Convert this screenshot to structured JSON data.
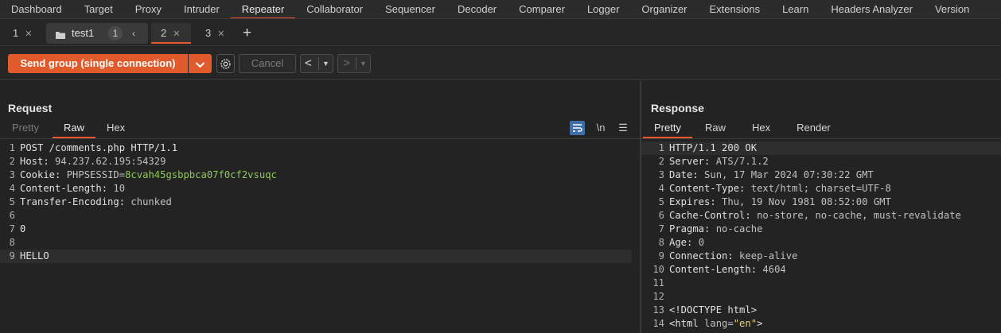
{
  "nav": {
    "items": [
      "Dashboard",
      "Target",
      "Proxy",
      "Intruder",
      "Repeater",
      "Collaborator",
      "Sequencer",
      "Decoder",
      "Comparer",
      "Logger",
      "Organizer",
      "Extensions",
      "Learn",
      "Headers Analyzer",
      "Version"
    ],
    "active": "Repeater"
  },
  "tabs": {
    "tab1": {
      "label": "1"
    },
    "group": {
      "label": "test1",
      "count": "1"
    },
    "tab2": {
      "label": "2"
    },
    "tab3": {
      "label": "3"
    },
    "add": "+"
  },
  "toolbar": {
    "send_label": "Send group (single connection)",
    "cancel_label": "Cancel"
  },
  "request": {
    "title": "Request",
    "tabs": [
      "Pretty",
      "Raw",
      "Hex"
    ],
    "active_tab": "Raw",
    "newline_icon_label": "\\n",
    "lines": [
      {
        "num": "1",
        "text": "POST /comments.php HTTP/1.1"
      },
      {
        "num": "2",
        "key": "Host:",
        "value": " 94.237.62.195:54329"
      },
      {
        "num": "3",
        "key": "Cookie:",
        "value": " PHPSESSID=",
        "value2": "8cvah45gsbpbca07f0cf2vsuqc"
      },
      {
        "num": "4",
        "key": "Content-Length:",
        "value": " 10"
      },
      {
        "num": "5",
        "key": "Transfer-Encoding:",
        "value": " chunked"
      },
      {
        "num": "6",
        "text": ""
      },
      {
        "num": "7",
        "text": "0"
      },
      {
        "num": "8",
        "text": ""
      },
      {
        "num": "9",
        "text": "HELLO"
      }
    ]
  },
  "response": {
    "title": "Response",
    "tabs": [
      "Pretty",
      "Raw",
      "Hex",
      "Render"
    ],
    "active_tab": "Pretty",
    "lines": [
      {
        "num": "1",
        "text": "HTTP/1.1 200 OK"
      },
      {
        "num": "2",
        "key": "Server:",
        "value": " ATS/7.1.2"
      },
      {
        "num": "3",
        "key": "Date:",
        "value": " Sun, 17 Mar 2024 07:30:22 GMT"
      },
      {
        "num": "4",
        "key": "Content-Type:",
        "value": " text/html; charset=UTF-8"
      },
      {
        "num": "5",
        "key": "Expires:",
        "value": " Thu, 19 Nov 1981 08:52:00 GMT"
      },
      {
        "num": "6",
        "key": "Cache-Control:",
        "value": " no-store, no-cache, must-revalidate"
      },
      {
        "num": "7",
        "key": "Pragma:",
        "value": " no-cache"
      },
      {
        "num": "8",
        "key": "Age:",
        "value": " 0"
      },
      {
        "num": "9",
        "key": "Connection:",
        "value": " keep-alive"
      },
      {
        "num": "10",
        "key": "Content-Length:",
        "value": " 4604"
      },
      {
        "num": "11",
        "text": ""
      },
      {
        "num": "12",
        "text": ""
      },
      {
        "num": "13",
        "text": "<!DOCTYPE html>"
      },
      {
        "num": "14",
        "tag": "<html",
        "attr": " lang=",
        "str": "\"en\"",
        "end": ">"
      }
    ]
  },
  "colors": {
    "accent": "#e8582f",
    "send_button": "#e05a2b"
  }
}
